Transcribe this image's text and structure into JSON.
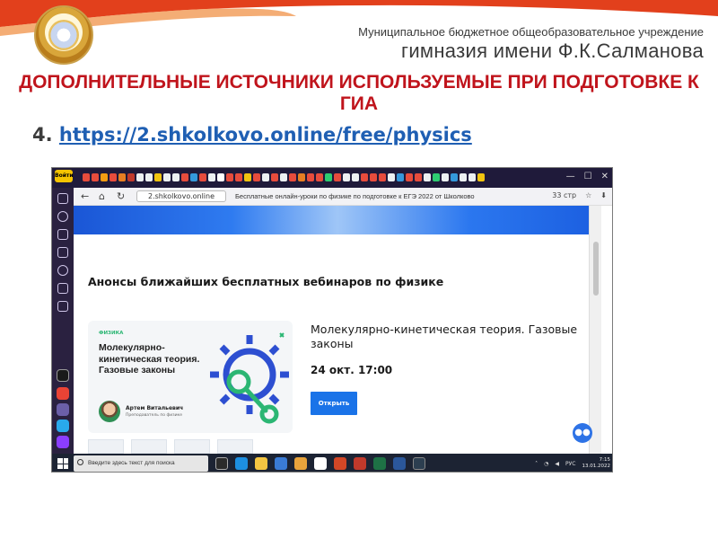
{
  "slide": {
    "org_line1": "Муниципальное бюджетное общеобразовательное учреждение",
    "org_line2": "гимназия имени Ф.К.Салманова",
    "title": "ДОПОЛНИТЕЛЬНЫЕ ИСТОЧНИКИ ИСПОЛЬЗУЕМЫЕ ПРИ ПОДГОТОВКЕ К ГИА",
    "item_number": "4.",
    "item_link": "https://2.shkolkovo.online/free/physics"
  },
  "browser": {
    "sidebar_badge": "Войти",
    "address": "2.shkolkovo.online",
    "page_title": "Бесплатные онлайн-уроки по физике по подготовке к ЕГЭ 2022 от Школково",
    "toolbar_extra": "33 стр",
    "nav_back": "←",
    "nav_home": "⌂",
    "nav_reload": "↻",
    "win_min": "—",
    "win_max": "☐",
    "win_close": "✕"
  },
  "page": {
    "section_heading": "Анонсы ближайших бесплатных вебинаров по физике",
    "card": {
      "subject": "ФИЗИКА",
      "card_title": "Молекулярно-кинетическая теория. Газовые законы",
      "teacher_name": "Артем Витальевич",
      "teacher_role": "Преподаватель по физике"
    },
    "event_title": "Молекулярно-кинетическая теория. Газовые законы",
    "event_date": "24 окт. 17:00",
    "open_button": "Открыть",
    "chat_icon": "speech-bubble"
  },
  "taskbar": {
    "search_placeholder": "Введите здесь текст для поиска",
    "lang": "РУС",
    "time": "7:15",
    "date": "13.01.2022"
  },
  "colors": {
    "title_red": "#c0141c",
    "link_blue": "#1f5fb3",
    "button_blue": "#1a73e8"
  }
}
